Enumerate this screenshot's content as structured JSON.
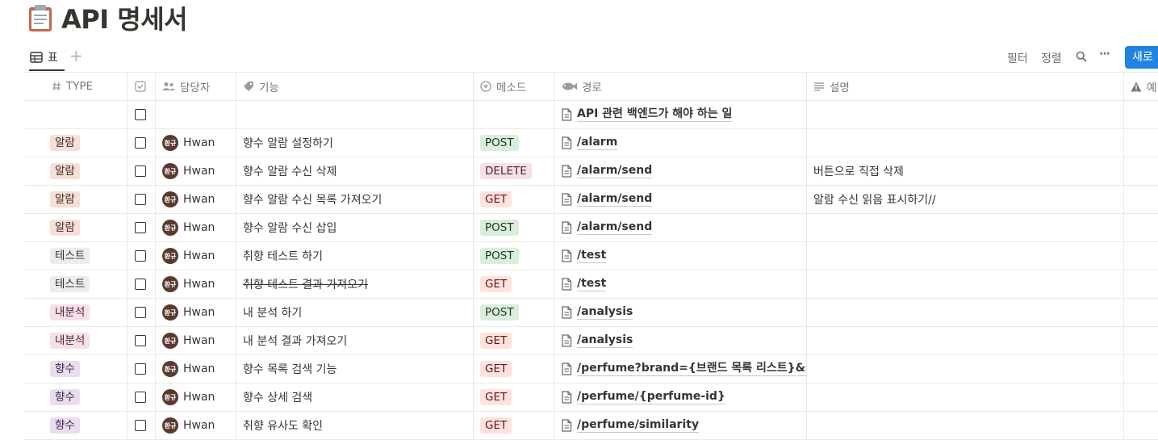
{
  "page": {
    "title": "API 명세서",
    "title_icon": "clipboard-icon"
  },
  "toolbar": {
    "view_label": "표",
    "add_view": "+",
    "filter_label": "필터",
    "sort_label": "정렬",
    "more_label": "···",
    "new_label": "새로"
  },
  "columns": [
    {
      "key": "type",
      "label": "TYPE",
      "icon": "number-icon"
    },
    {
      "key": "done",
      "label": "",
      "icon": "checkbox-icon"
    },
    {
      "key": "assignee",
      "label": "담당자",
      "icon": "people-icon"
    },
    {
      "key": "feature",
      "label": "기능",
      "icon": "tag-icon"
    },
    {
      "key": "method",
      "label": "메소드",
      "icon": "select-icon"
    },
    {
      "key": "path",
      "label": "경로",
      "icon": "fish-icon"
    },
    {
      "key": "desc",
      "label": "설명",
      "icon": "text-lines-icon"
    },
    {
      "key": "extra",
      "label": "예",
      "icon": "warning-icon"
    }
  ],
  "rows": [
    {
      "type": "",
      "assignee": "",
      "feature": "",
      "method": "",
      "path": "API 관련 백엔드가 해야 하는 일",
      "desc": ""
    },
    {
      "type": "알람",
      "assignee": "Hwan",
      "feature": "향수 알람 설정하기",
      "method": "POST",
      "path": "/alarm",
      "desc": ""
    },
    {
      "type": "알람",
      "assignee": "Hwan",
      "feature": "향수 알람 수신 삭제",
      "method": "DELETE",
      "path": "/alarm/send",
      "desc": "버튼으로 직접 삭제"
    },
    {
      "type": "알람",
      "assignee": "Hwan",
      "feature": "향수 알람 수신 목록 가져오기",
      "method": "GET",
      "path": "/alarm/send",
      "desc": "알람 수신 읽음 표시하기//"
    },
    {
      "type": "알람",
      "assignee": "Hwan",
      "feature": "향수 알람 수신 삽입",
      "method": "POST",
      "path": "/alarm/send",
      "desc": ""
    },
    {
      "type": "테스트",
      "assignee": "Hwan",
      "feature": "취향 테스트 하기",
      "method": "POST",
      "path": "/test",
      "desc": ""
    },
    {
      "type": "테스트",
      "assignee": "Hwan",
      "feature": "취향 테스트 결과 가져오기",
      "method": "GET",
      "path": "/test",
      "desc": "",
      "strike": true
    },
    {
      "type": "내분석",
      "assignee": "Hwan",
      "feature": "내 분석 하기",
      "method": "POST",
      "path": "/analysis",
      "desc": ""
    },
    {
      "type": "내분석",
      "assignee": "Hwan",
      "feature": "내 분석 결과 가져오기",
      "method": "GET",
      "path": "/analysis",
      "desc": ""
    },
    {
      "type": "향수",
      "assignee": "Hwan",
      "feature": "향수 목록 검색 기능",
      "method": "GET",
      "path": "/perfume?brand={브랜드 목록 리스트}&scen",
      "desc": ""
    },
    {
      "type": "향수",
      "assignee": "Hwan",
      "feature": "향수 상세 검색",
      "method": "GET",
      "path": "/perfume/{perfume-id}",
      "desc": ""
    },
    {
      "type": "향수",
      "assignee": "Hwan",
      "feature": "취향 유사도 확인",
      "method": "GET",
      "path": "/perfume/similarity",
      "desc": ""
    }
  ],
  "avatar_text": "환규",
  "colors": {
    "type": {
      "알람": "#f4e0d9",
      "테스트": "#ebeced",
      "내분석": "#f5e0e9",
      "향수": "#e8deee"
    },
    "method": {
      "POST": "#dbeddb",
      "DELETE": "#f5e0e9",
      "GET": "#ffe2dd"
    },
    "method_text": {
      "POST": "#1c3829",
      "DELETE": "#4c2337",
      "GET": "#5d1715"
    },
    "type_text": {
      "알람": "#442a1e",
      "테스트": "#32302c",
      "내분석": "#4c2337",
      "향수": "#412454"
    },
    "accent": "#2383e2"
  }
}
